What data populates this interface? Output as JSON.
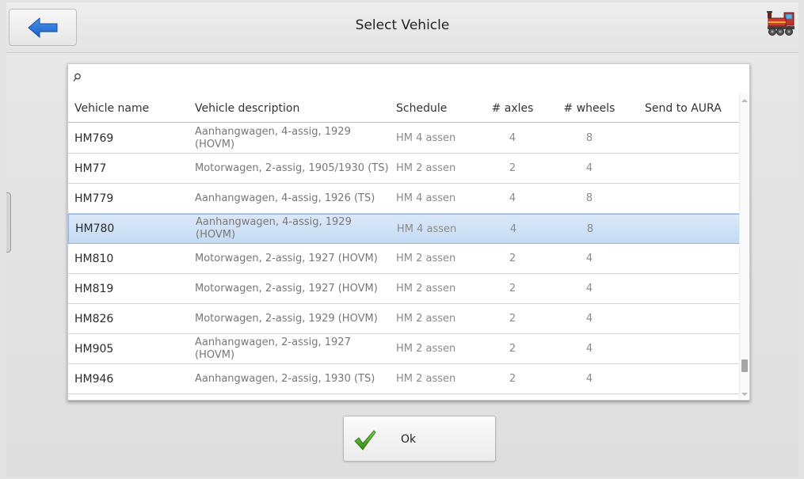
{
  "header": {
    "title": "Select Vehicle",
    "back_icon": "arrow-left-icon",
    "app_icon": "train-locomotive-icon"
  },
  "search": {
    "icon": "search-icon",
    "value": "",
    "placeholder": ""
  },
  "table": {
    "columns": [
      "Vehicle name",
      "Vehicle description",
      "Schedule",
      "# axles",
      "# wheels",
      "Send to AURA"
    ],
    "rows": [
      {
        "name": "HM769",
        "description": "Aanhangwagen, 4-assig, 1929 (HOVM)",
        "schedule": "HM 4 assen",
        "axles": "4",
        "wheels": "8",
        "aura": "",
        "selected": false
      },
      {
        "name": "HM77",
        "description": "Motorwagen, 2-assig, 1905/1930 (TS)",
        "schedule": "HM 2 assen",
        "axles": "2",
        "wheels": "4",
        "aura": "",
        "selected": false
      },
      {
        "name": "HM779",
        "description": "Aanhangwagen, 4-assig, 1926 (TS)",
        "schedule": "HM 4 assen",
        "axles": "4",
        "wheels": "8",
        "aura": "",
        "selected": false
      },
      {
        "name": "HM780",
        "description": "Aanhangwagen, 4-assig, 1929 (HOVM)",
        "schedule": "HM 4 assen",
        "axles": "4",
        "wheels": "8",
        "aura": "",
        "selected": true
      },
      {
        "name": "HM810",
        "description": "Motorwagen, 2-assig, 1927 (HOVM)",
        "schedule": "HM 2 assen",
        "axles": "2",
        "wheels": "4",
        "aura": "",
        "selected": false
      },
      {
        "name": "HM819",
        "description": "Motorwagen, 2-assig, 1927 (HOVM)",
        "schedule": "HM 2 assen",
        "axles": "2",
        "wheels": "4",
        "aura": "",
        "selected": false
      },
      {
        "name": "HM826",
        "description": "Motorwagen, 2-assig, 1929 (HOVM)",
        "schedule": "HM 2 assen",
        "axles": "2",
        "wheels": "4",
        "aura": "",
        "selected": false
      },
      {
        "name": "HM905",
        "description": "Aanhangwagen, 2-assig, 1927 (HOVM)",
        "schedule": "HM 2 assen",
        "axles": "2",
        "wheels": "4",
        "aura": "",
        "selected": false
      },
      {
        "name": "HM946",
        "description": "Aanhangwagen, 2-assig, 1930 (TS)",
        "schedule": "HM 2 assen",
        "axles": "2",
        "wheels": "4",
        "aura": "",
        "selected": false
      }
    ]
  },
  "footer": {
    "ok_label": "Ok",
    "ok_icon": "checkmark-icon"
  },
  "colors": {
    "accent_blue": "#1e6fd6",
    "selection": "#c4dbf3",
    "check_green": "#3a9a1a"
  }
}
